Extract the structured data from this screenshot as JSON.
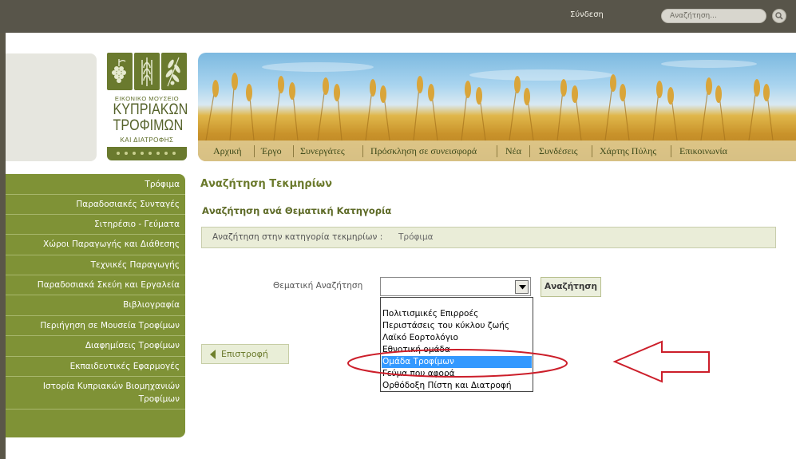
{
  "header": {
    "login_label": "Σύνδεση",
    "search_placeholder": "Αναζήτηση..."
  },
  "logo": {
    "line1": "ΕΙΚΟΝΙΚΟ ΜΟΥΣΕΙΟ",
    "line2": "ΚΥΠΡΙΑΚΩΝ",
    "line3": "ΤΡΟΦΙΜΩΝ",
    "line4": "ΚΑΙ ΔΙΑΤΡΟΦΗΣ"
  },
  "nav": {
    "items": [
      "Αρχική",
      "Έργο",
      "Συνεργάτες",
      "Πρόσκληση σε συνεισφορά",
      "Νέα",
      "Συνδέσεις",
      "Χάρτης Πύλης",
      "Επικοινωνία"
    ]
  },
  "sidebar": {
    "items": [
      "Τρόφιμα",
      "Παραδοσιακές Συνταγές",
      "Σιτηρέσιο - Γεύματα",
      "Χώροι Παραγωγής και Διάθεσης",
      "Τεχνικές Παραγωγής",
      "Παραδοσιακά Σκεύη και Εργαλεία",
      "Βιβλιογραφία",
      "Περιήγηση σε Μουσεία Τροφίμων",
      "Διαφημίσεις Τροφίμων",
      "Εκπαιδευτικές Εφαρμογές",
      "Ιστορία Κυπριακών Βιομηχανιών",
      "Τροφίμων"
    ]
  },
  "main": {
    "title": "Αναζήτηση Τεκμηρίων",
    "subtitle": "Αναζήτηση ανά Θεματική Κατηγορία",
    "category_label": "Αναζήτηση στην κατηγορία τεκμηρίων :",
    "category_value": "Τρόφιμα",
    "thematic_label": "Θεματική Αναζήτηση",
    "select_value": "",
    "search_button": "Αναζήτηση",
    "back_button": "Επιστροφή",
    "options": [
      "Πολιτισμικές Επιρροές",
      "Περιστάσεις του κύκλου ζωής",
      "Λαϊκό Εορτολόγιο",
      "Εθνοτική ομάδα",
      "Ομάδα Τροφίμων",
      "Γεύμα που αφορά",
      "Ορθόδοξη Πίστη και Διατροφή"
    ],
    "selected_option_index": 4
  },
  "colors": {
    "accent_green": "#7f9236",
    "highlight_blue": "#3399ff",
    "annotation_red": "#cc1e2a"
  }
}
